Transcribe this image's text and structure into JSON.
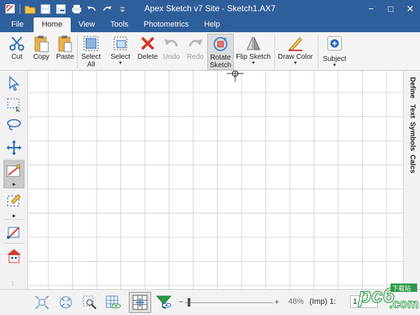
{
  "window": {
    "title": "Apex Sketch v7 Site - Sketch1.AX7",
    "minimize": "−",
    "maximize": "□",
    "close": "✕"
  },
  "quick_access": [
    "folder-icon",
    "save-icon",
    "save-as-icon",
    "print-icon",
    "undo-icon",
    "redo-icon",
    "customize-icon"
  ],
  "menu_tabs": [
    {
      "label": "File",
      "active": false
    },
    {
      "label": "Home",
      "active": true
    },
    {
      "label": "View",
      "active": false
    },
    {
      "label": "Tools",
      "active": false
    },
    {
      "label": "Photometrics",
      "active": false
    },
    {
      "label": "Help",
      "active": false
    }
  ],
  "ribbon": {
    "cut": "Cut",
    "copy": "Copy",
    "paste": "Paste",
    "select_all": "Select All",
    "select": "Select",
    "delete": "Delete",
    "undo": "Undo",
    "redo": "Redo",
    "rotate_sketch": "Rotate Sketch",
    "flip_sketch": "Flip Sketch",
    "draw_color": "Draw Color",
    "subject": "Subject"
  },
  "left_tools": [
    "select-arrow-icon",
    "rectangle-select-icon",
    "lasso-icon",
    "move-icon",
    "draw-line-icon",
    "draw-area-icon",
    "edit-area-icon",
    "house-icon"
  ],
  "right_tabs": [
    "Define",
    "Text",
    "Symbols",
    "Calcs"
  ],
  "bottom_tools": [
    "zoom-fit-icon",
    "zoom-extents-icon",
    "zoom-window-icon",
    "grid-view-icon",
    "grid-toggle-icon",
    "filter-icon"
  ],
  "status": {
    "zoom": "48%",
    "scale_label": "(Imp)  1:",
    "scale_value": "1",
    "zoom_minus": "−",
    "zoom_plus": "+",
    "zoom_level": 0.48
  },
  "watermark": {
    "logo_text": "pc6",
    "site": "下载站",
    "domain": ".com"
  },
  "colors": {
    "title_bar": "#2f5f9a",
    "accent_red": "#d23a2a",
    "accent_blue": "#2a6cbf",
    "watermark_green": "#2e9a46"
  }
}
